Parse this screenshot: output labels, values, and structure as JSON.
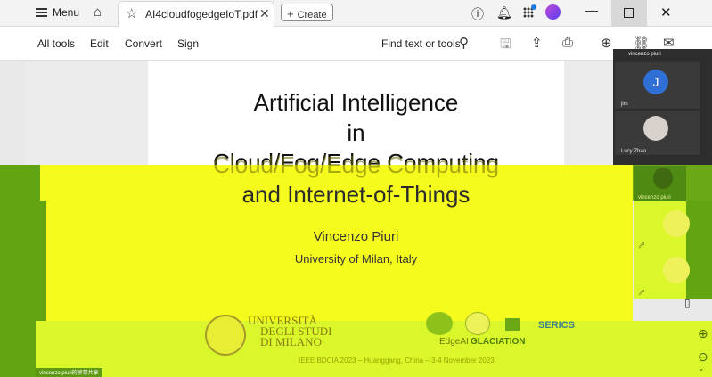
{
  "titlebar": {
    "menu_label": "Menu",
    "tab_title": "AI4cloudfogedgeIoT.pdf",
    "create_label": "Create"
  },
  "toolbar": {
    "all_tools": "All tools",
    "edit": "Edit",
    "convert": "Convert",
    "sign": "Sign",
    "find": "Find text or tools"
  },
  "slide": {
    "title_line1": "Artificial Intelligence",
    "title_line2": "in",
    "title_line3": "Cloud/Fog/Edge Computing",
    "title_line4": "and Internet-of-Things",
    "author": "Vincenzo Piuri",
    "affiliation": "University of Milan, Italy",
    "uni_line1": "UNIVERSITÀ",
    "uni_line2": "DEGLI STUDI",
    "uni_line3": "DI MILANO",
    "edgeai": "EdgeAI",
    "glaciation": "GLACIATION",
    "serics": "SERICS",
    "footer": "IEEE BDCIA 2023 – Huanggang, China – 3-4 November 2023"
  },
  "meeting": {
    "header_name": "vincenzo piuri",
    "tile1_initial": "J",
    "tile1_name": "jim",
    "tile2_name": "Lucy Zhao",
    "tile3_name": "vincenzo piuri",
    "presenter_label": "vincenzo piuri的屏幕共享"
  },
  "colors": {
    "highlight_yellow": "#f6fb1e",
    "highlight_lime": "#d9f72a",
    "highlight_green": "#63a411",
    "avatar_blue": "#2f6fd6"
  }
}
